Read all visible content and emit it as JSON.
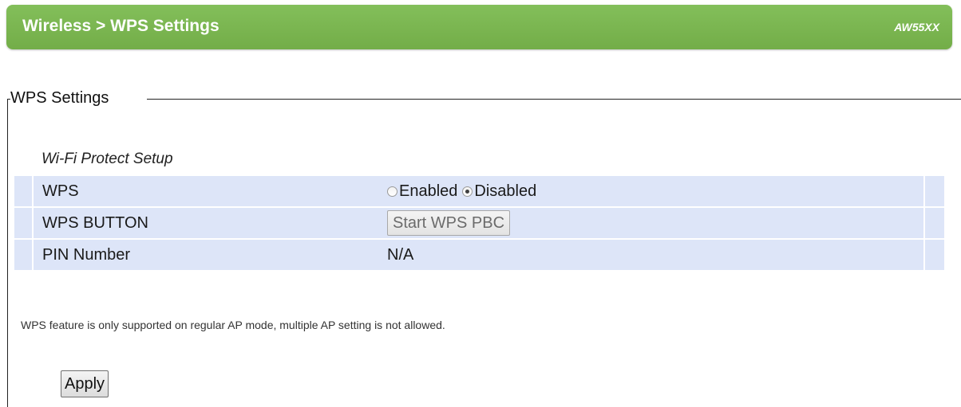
{
  "header": {
    "breadcrumb": "Wireless > WPS Settings",
    "model": "AW55XX",
    "bar_color": "#7cb752"
  },
  "fieldset": {
    "legend": "WPS Settings"
  },
  "section": {
    "title": "Wi-Fi Protect Setup"
  },
  "rows": {
    "wps": {
      "label": "WPS",
      "options": [
        {
          "label": "Enabled",
          "checked": false
        },
        {
          "label": "Disabled",
          "checked": true
        }
      ]
    },
    "wps_button": {
      "label": "WPS BUTTON",
      "button_label": "Start WPS PBC"
    },
    "pin": {
      "label": "PIN Number",
      "value": "N/A"
    }
  },
  "note": "WPS feature is only supported on regular AP mode, multiple AP setting is not allowed.",
  "apply_label": "Apply",
  "colors": {
    "row_background": "#dde5f8"
  }
}
